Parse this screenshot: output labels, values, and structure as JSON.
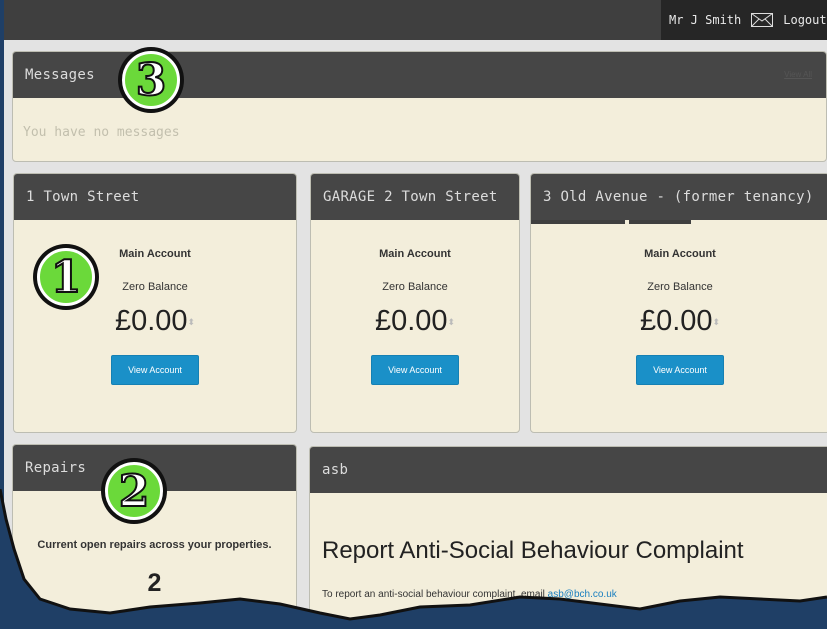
{
  "header": {
    "user_name": "Mr J Smith",
    "logout_label": "Logout"
  },
  "messages": {
    "title": "Messages",
    "view_all_label": "View All",
    "empty_text": "You have no messages"
  },
  "accounts": [
    {
      "title": "1 Town Street",
      "account_label": "Main Account",
      "balance_status": "Zero Balance",
      "amount": "£0.00",
      "button_label": "View Account"
    },
    {
      "title": "GARAGE 2 Town Street",
      "account_label": "Main Account",
      "balance_status": "Zero Balance",
      "amount": "£0.00",
      "button_label": "View Account"
    },
    {
      "title": "3 Old Avenue - (former tenancy)",
      "account_label": "Main Account",
      "balance_status": "Zero Balance",
      "amount": "£0.00",
      "button_label": "View Account"
    }
  ],
  "repairs": {
    "title": "Repairs",
    "description": "Current open repairs across your properties.",
    "count": "2"
  },
  "asb": {
    "title": "asb",
    "heading": "Report Anti-Social Behaviour Complaint",
    "text": "To report an anti-social behaviour complaint, email ",
    "email": "asb@bch.co.uk"
  },
  "badges": [
    "1",
    "2",
    "3"
  ],
  "colors": {
    "accent_button": "#1a90c8",
    "panel_header": "#464646",
    "panel_body": "#f3eedb",
    "badge_green": "#6bd93a",
    "background_blue": "#1f3f66"
  },
  "icons": {
    "envelope": "envelope-icon"
  }
}
